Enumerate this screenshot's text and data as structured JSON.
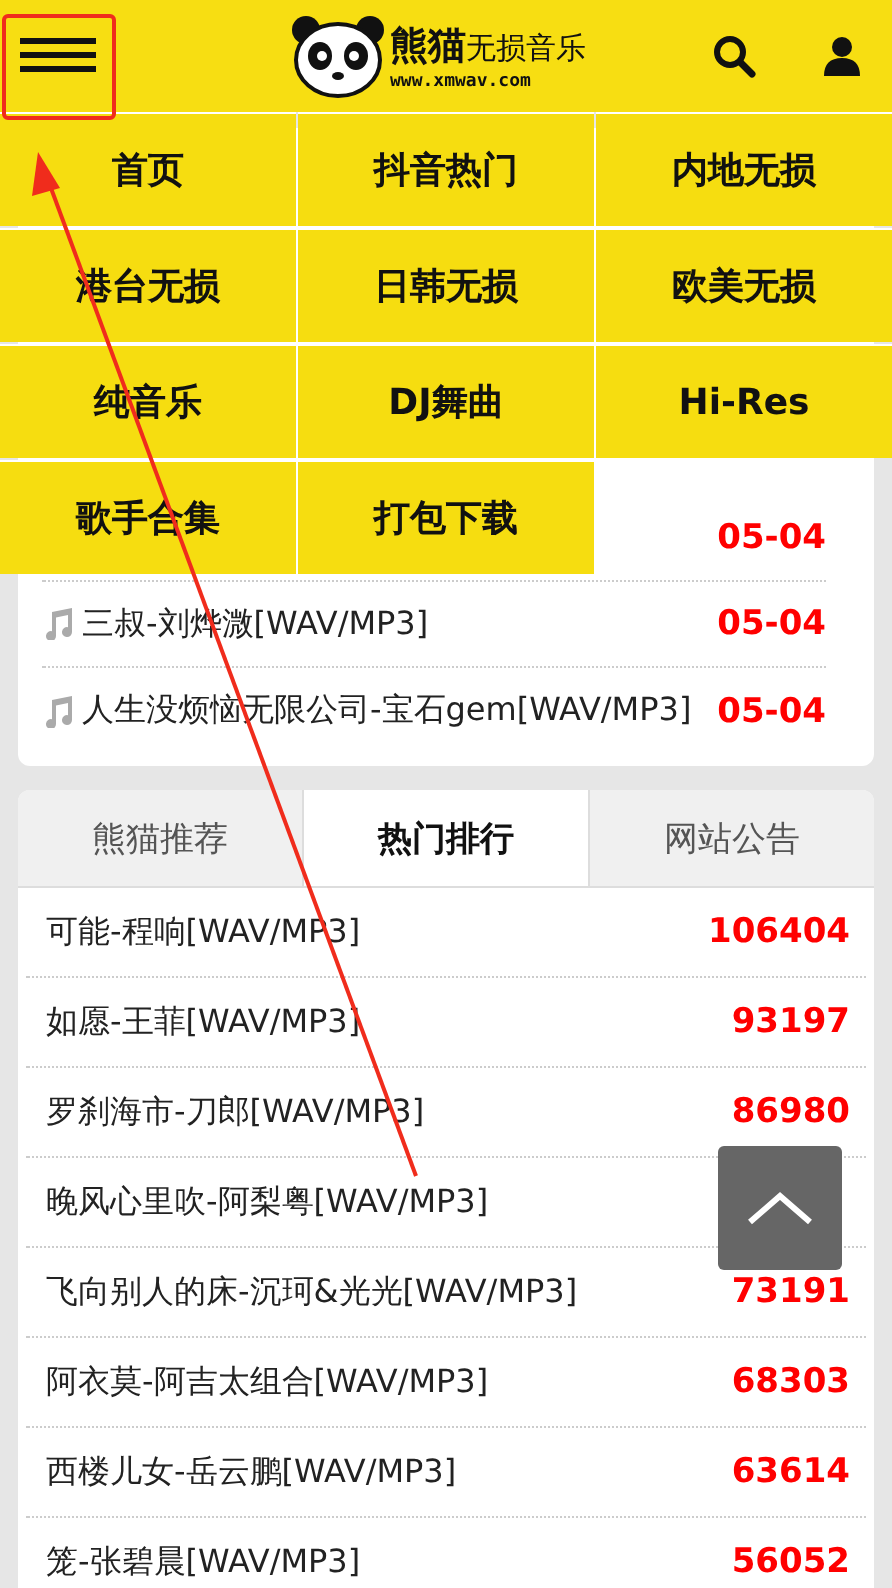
{
  "header": {
    "logo_title": "熊猫",
    "logo_subtitle": "无损音乐",
    "logo_url": "www.xmwav.com"
  },
  "menu": {
    "items": [
      "首页",
      "抖音热门",
      "内地无损",
      "港台无损",
      "日韩无损",
      "欧美无损",
      "纯音乐",
      "DJ舞曲",
      "Hi-Res",
      "歌手合集",
      "打包下载"
    ]
  },
  "latest": [
    {
      "date": "05-04"
    },
    {
      "title": "三叔-刘烨溦[WAV/MP3]",
      "date": "05-04"
    },
    {
      "title": "人生没烦恼无限公司-宝石gem[WAV/MP3]",
      "date": "05-04"
    }
  ],
  "tabs": [
    {
      "label": "熊猫推荐",
      "selected": false
    },
    {
      "label": "热门排行",
      "selected": true
    },
    {
      "label": "网站公告",
      "selected": false
    }
  ],
  "ranking": [
    {
      "title": "可能-程响[WAV/MP3]",
      "count": "106404"
    },
    {
      "title": "如愿-王菲[WAV/MP3]",
      "count": "93197"
    },
    {
      "title": "罗刹海市-刀郎[WAV/MP3]",
      "count": "86980"
    },
    {
      "title": "晚风心里吹-阿梨粤[WAV/MP3]"
    },
    {
      "title": "飞向别人的床-沉珂&光光[WAV/MP3]",
      "count": "73191"
    },
    {
      "title": "阿衣莫-阿吉太组合[WAV/MP3]",
      "count": "68303"
    },
    {
      "title": "西楼儿女-岳云鹏[WAV/MP3]",
      "count": "63614"
    },
    {
      "title": "笼-张碧晨[WAV/MP3]",
      "count": "56052"
    }
  ]
}
